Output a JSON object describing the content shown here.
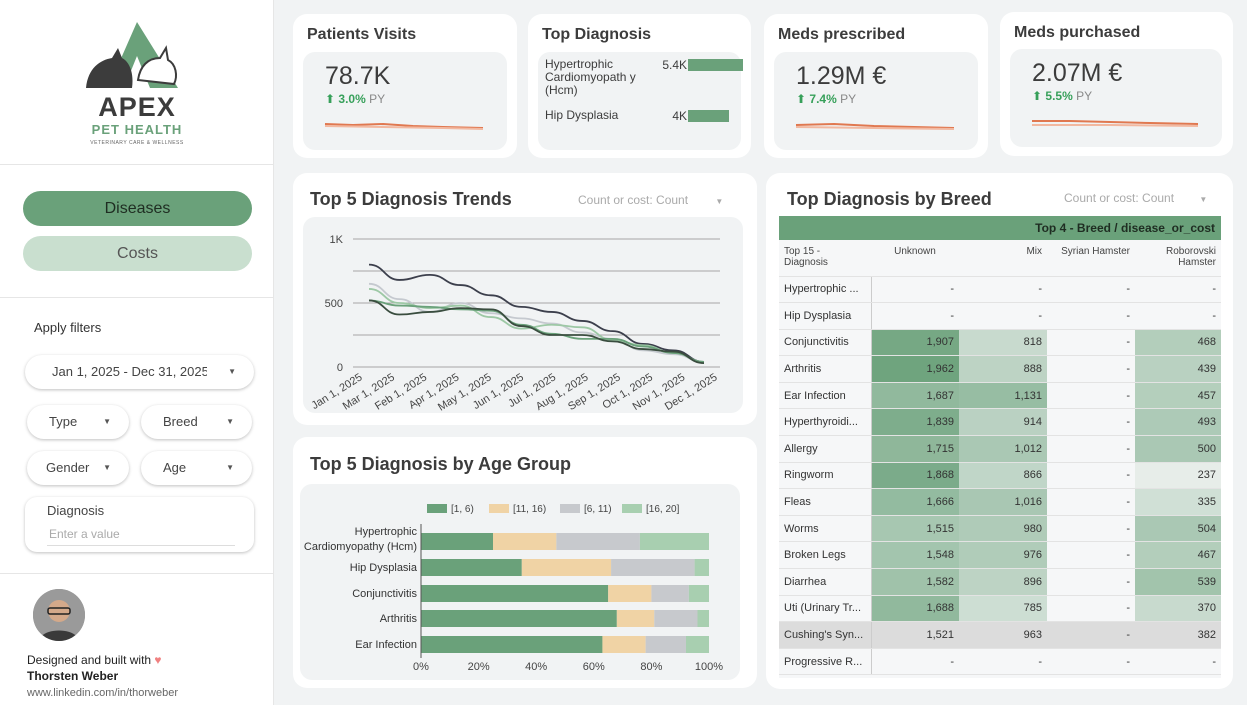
{
  "sidebar": {
    "logo": {
      "title": "APEX",
      "subtitle": "PET HEALTH",
      "tagline": "VETERINARY CARE & WELLNESS"
    },
    "tabs": {
      "diseases": "Diseases",
      "costs": "Costs"
    },
    "filters_label": "Apply filters",
    "date_range": "Jan 1, 2025 - Dec 31, 2025",
    "filters": {
      "type": "Type",
      "breed": "Breed",
      "gender": "Gender",
      "age": "Age"
    },
    "diagnosis": {
      "label": "Diagnosis",
      "placeholder": "Enter a value"
    },
    "credit": {
      "line1": "Designed and built with",
      "heart": "♥",
      "name": "Thorsten Weber",
      "link": "www.linkedin.com/in/thorweber"
    }
  },
  "kpis": {
    "patients": {
      "title": "Patients Visits",
      "value": "78.7K",
      "delta": "3.0%",
      "suffix": "PY"
    },
    "meds_prescribed": {
      "title": "Meds prescribed",
      "value": "1.29M €",
      "delta": "7.4%",
      "suffix": "PY"
    },
    "meds_purchased": {
      "title": "Meds purchased",
      "value": "2.07M €",
      "delta": "5.5%",
      "suffix": "PY"
    }
  },
  "top_diagnosis": {
    "title": "Top Diagnosis",
    "items": [
      {
        "label": "Hypertrophic Cardiomyopath y (Hcm)",
        "value": "5.4K",
        "fraction": 1.0
      },
      {
        "label": "Hip Dysplasia",
        "value": "4K",
        "fraction": 0.74
      }
    ]
  },
  "trends": {
    "title": "Top 5 Diagnosis Trends",
    "control_label": "Count or cost:",
    "control_value": "Count"
  },
  "age_group": {
    "title": "Top 5 Diagnosis by Age Group"
  },
  "breed_table": {
    "title": "Top Diagnosis  by Breed",
    "control_label": "Count or cost:",
    "control_value": "Count",
    "banner": "Top 4 - Breed / disease_or_cost",
    "headers": [
      "Top 15 - Diagnosis",
      "Unknown",
      "Mix",
      "Syrian Hamster",
      "Roborovski Hamster"
    ],
    "rows": [
      [
        "Hypertrophic ...",
        "-",
        "-",
        "-",
        "-"
      ],
      [
        "Hip Dysplasia",
        "-",
        "-",
        "-",
        "-"
      ],
      [
        "Conjunctivitis",
        "1,907",
        "818",
        "-",
        "468"
      ],
      [
        "Arthritis",
        "1,962",
        "888",
        "-",
        "439"
      ],
      [
        "Ear Infection",
        "1,687",
        "1,131",
        "-",
        "457"
      ],
      [
        "Hyperthyroidi...",
        "1,839",
        "914",
        "-",
        "493"
      ],
      [
        "Allergy",
        "1,715",
        "1,012",
        "-",
        "500"
      ],
      [
        "Ringworm",
        "1,868",
        "866",
        "-",
        "237"
      ],
      [
        "Fleas",
        "1,666",
        "1,016",
        "-",
        "335"
      ],
      [
        "Worms",
        "1,515",
        "980",
        "-",
        "504"
      ],
      [
        "Broken Legs",
        "1,548",
        "976",
        "-",
        "467"
      ],
      [
        "Diarrhea",
        "1,582",
        "896",
        "-",
        "539"
      ],
      [
        "Uti (Urinary Tr...",
        "1,688",
        "785",
        "-",
        "370"
      ],
      [
        "Cushing's Syn...",
        "1,521",
        "963",
        "-",
        "382"
      ],
      [
        "Progressive R...",
        "-",
        "-",
        "-",
        "-"
      ]
    ]
  },
  "chart_data": [
    {
      "type": "line",
      "title": "Top 5 Diagnosis Trends",
      "categories": [
        "Jan 1, 2025",
        "Mar 1, 2025",
        "Feb 1, 2025",
        "Apr 1, 2025",
        "May 1, 2025",
        "Jun 1, 2025",
        "Jul 1, 2025",
        "Aug 1, 2025",
        "Sep 1, 2025",
        "Oct 1, 2025",
        "Nov 1, 2025",
        "Dec 1, 2025"
      ],
      "yticks": [
        "0",
        "500",
        "1K"
      ],
      "ylim": [
        0,
        1000
      ],
      "series": [
        {
          "values": [
            800,
            680,
            720,
            640,
            560,
            470,
            430,
            360,
            280,
            180,
            130,
            40
          ],
          "color": "#3c3f4c"
        },
        {
          "values": [
            650,
            530,
            430,
            500,
            420,
            380,
            340,
            270,
            220,
            130,
            100,
            40
          ],
          "color": "#c5c9cf"
        },
        {
          "values": [
            610,
            500,
            460,
            480,
            390,
            300,
            330,
            310,
            210,
            170,
            110,
            40
          ],
          "color": "#9dc8a5"
        },
        {
          "values": [
            520,
            480,
            470,
            450,
            440,
            330,
            260,
            220,
            220,
            160,
            110,
            40
          ],
          "color": "#6aa17a"
        },
        {
          "values": [
            520,
            410,
            430,
            460,
            450,
            320,
            250,
            250,
            200,
            140,
            120,
            30
          ],
          "color": "#3a4d3f"
        }
      ]
    },
    {
      "type": "bar",
      "title": "Top 5 Diagnosis by Age Group",
      "categories": [
        "Hypertrophic Cardiomyopathy (Hcm)",
        "Hip Dysplasia",
        "Conjunctivitis",
        "Arthritis",
        "Ear Infection"
      ],
      "xticks": [
        "0%",
        "20%",
        "40%",
        "60%",
        "80%",
        "100%"
      ],
      "series": [
        {
          "name": "[1, 6)",
          "color": "#6aa17a",
          "values": [
            25,
            35,
            65,
            68,
            63
          ]
        },
        {
          "name": "[11, 16)",
          "color": "#f0d3a5",
          "values": [
            22,
            31,
            15,
            13,
            15
          ]
        },
        {
          "name": "[6, 11)",
          "color": "#c7c9cd",
          "values": [
            29,
            29,
            13,
            15,
            14
          ]
        },
        {
          "name": "[16, 20]",
          "color": "#a8cfb0",
          "values": [
            24,
            5,
            7,
            4,
            8
          ]
        }
      ]
    }
  ]
}
